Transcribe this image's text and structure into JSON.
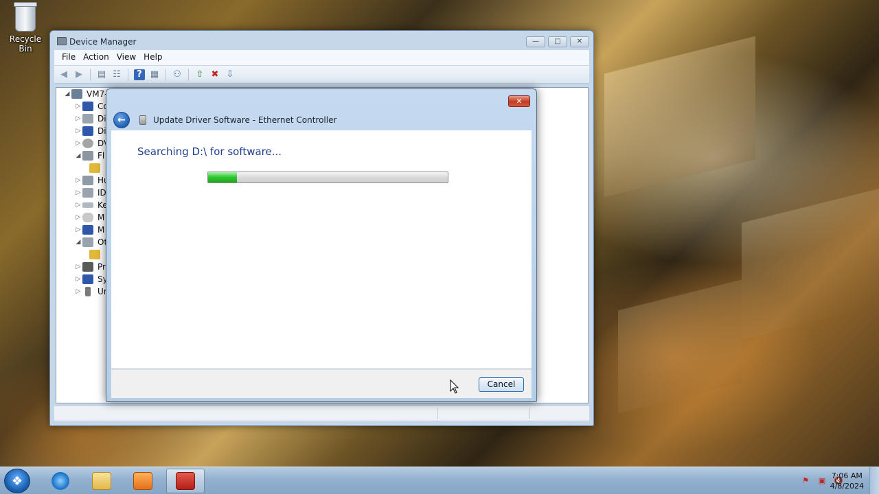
{
  "desktop": {
    "recycle_bin_label": "Recycle Bin"
  },
  "device_manager": {
    "title": "Device Manager",
    "menu": [
      "File",
      "Action",
      "View",
      "Help"
    ],
    "tree": {
      "root": "VM7-",
      "items": [
        "Co",
        "Di",
        "Di",
        "DV",
        "Fl",
        "",
        "Hu",
        "ID",
        "Ke",
        "M",
        "M",
        "Ot",
        "",
        "Pr",
        "Sy",
        "Ur"
      ]
    }
  },
  "dialog": {
    "title": "Update Driver Software - Ethernet Controller",
    "heading": "Searching D:\\ for software...",
    "progress_percent": 12,
    "cancel_label": "Cancel"
  },
  "taskbar": {
    "apps": [
      "start-orb",
      "internet-explorer",
      "file-explorer",
      "media-player",
      "device-manager"
    ],
    "clock_time": "7:06 AM",
    "clock_date": "4/8/2024"
  },
  "colors": {
    "dialog_heading": "#1e3e8c",
    "progress_green": "#2bc52b",
    "close_red": "#c23b22"
  }
}
